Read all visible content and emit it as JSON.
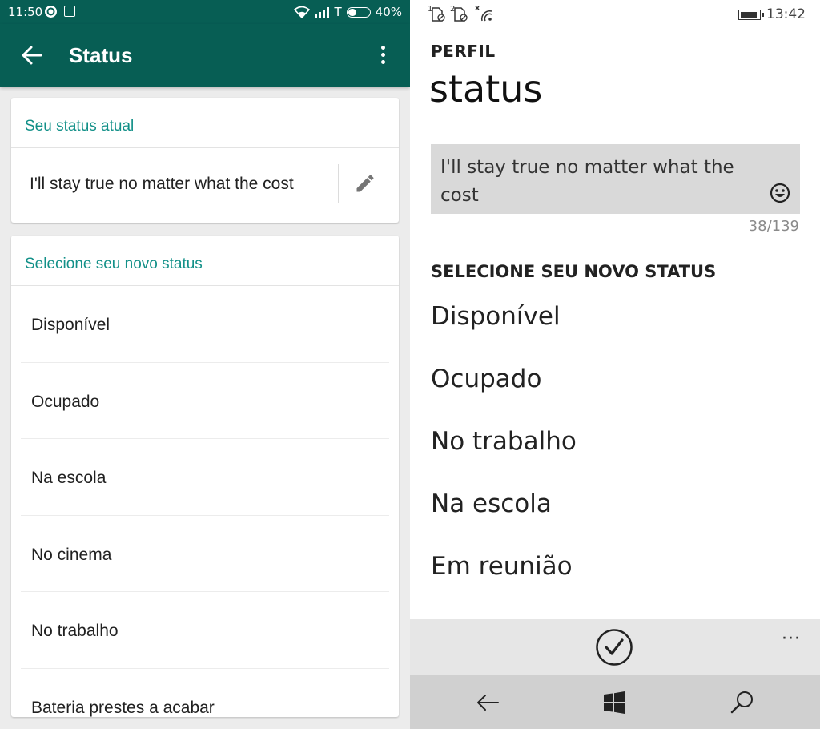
{
  "android": {
    "statusbar": {
      "time": "11:50",
      "carrier": "T",
      "battery": "40%",
      "battery_level": 0.4
    },
    "toolbar": {
      "title": "Status"
    },
    "current_card": {
      "header": "Seu status atual",
      "status_text": "I'll stay true no matter what the cost"
    },
    "options_card": {
      "header": "Selecione seu novo status",
      "items": [
        "Disponível",
        "Ocupado",
        "Na escola",
        "No cinema",
        "No trabalho",
        "Bateria prestes a acabar"
      ]
    },
    "colors": {
      "primary": "#075e54",
      "accent": "#129088"
    }
  },
  "wp": {
    "statusbar": {
      "time": "13:42",
      "sim1": "1",
      "sim2": "2"
    },
    "breadcrumb": "PERFIL",
    "title": "status",
    "input_value": "I'll stay true no matter what the cost",
    "counter": "38/139",
    "section_header": "SELECIONE SEU NOVO STATUS",
    "items": [
      "Disponível",
      "Ocupado",
      "No trabalho",
      "Na escola",
      "Em reunião"
    ],
    "appbar": {
      "more": "···"
    }
  }
}
